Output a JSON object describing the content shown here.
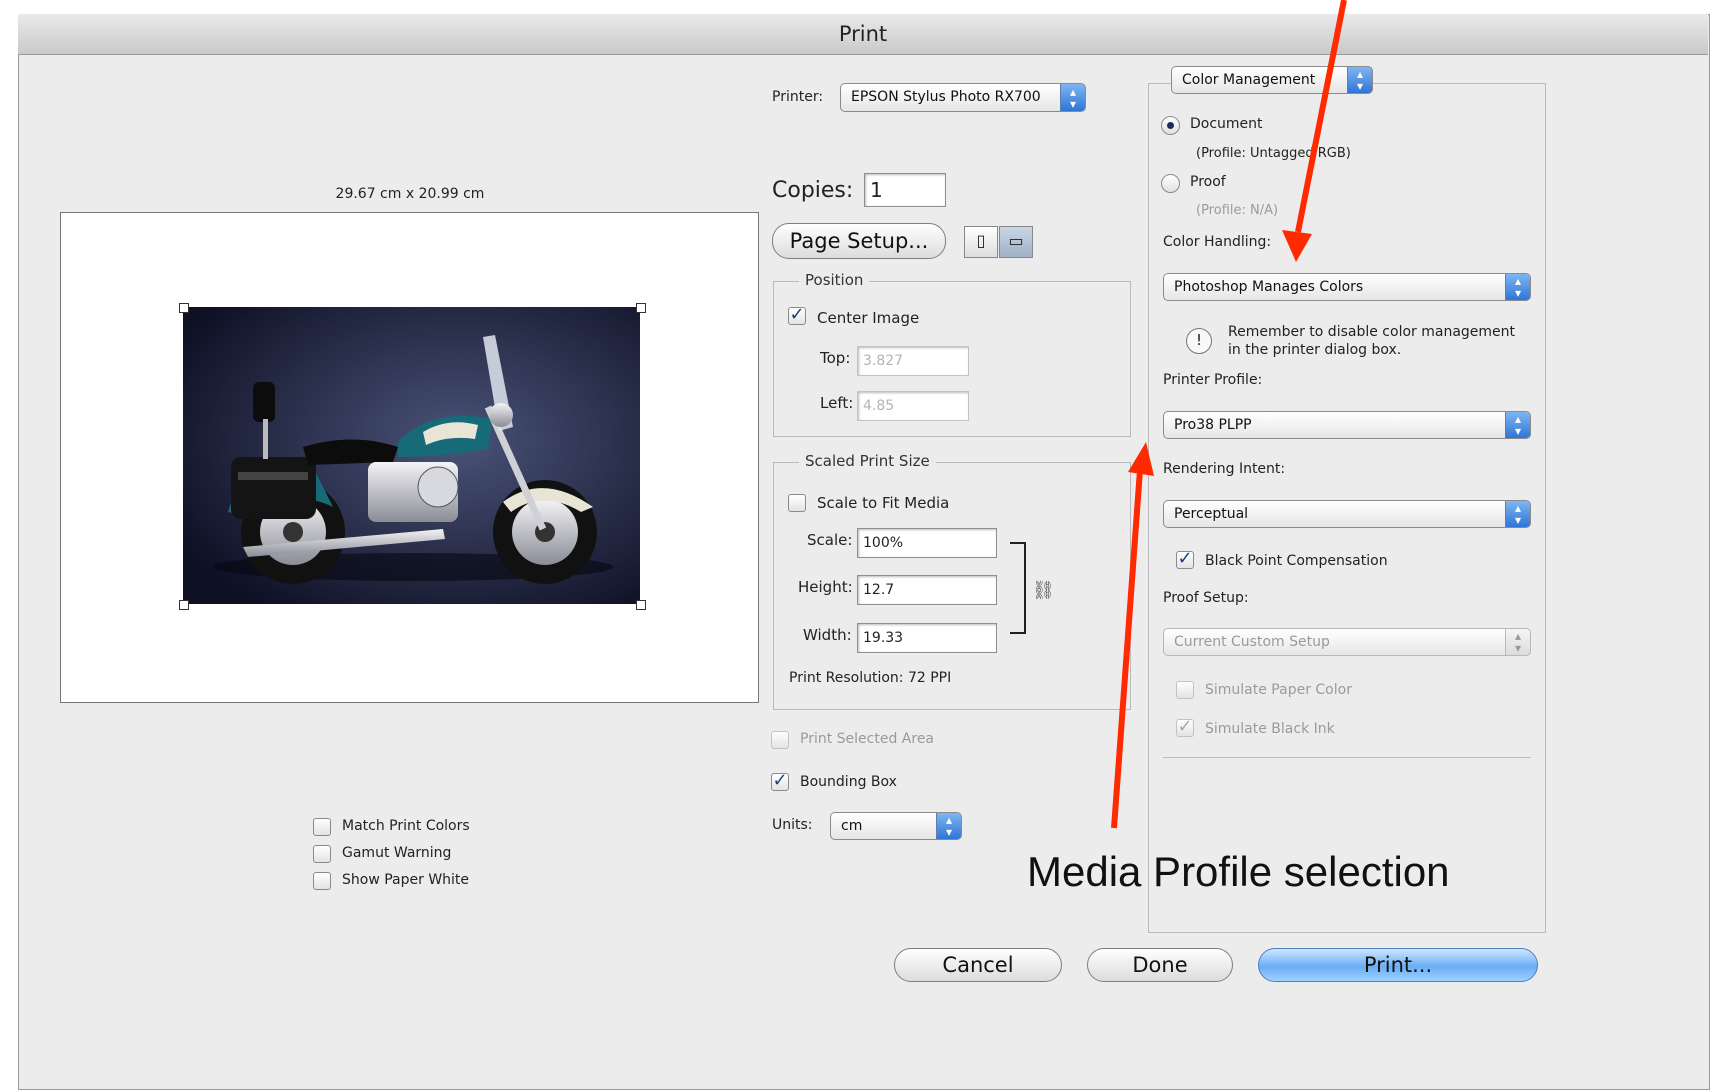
{
  "window": {
    "title": "Print"
  },
  "preview": {
    "dimensions": "29.67 cm x 20.99 cm",
    "image_description_icon": "motorcycle-photo"
  },
  "preview_options": [
    {
      "label": "Match Print Colors",
      "checked": false
    },
    {
      "label": "Gamut Warning",
      "checked": false
    },
    {
      "label": "Show Paper White",
      "checked": false
    }
  ],
  "printer": {
    "label": "Printer:",
    "value": "EPSON Stylus Photo RX700"
  },
  "copies": {
    "label": "Copies:",
    "value": "1"
  },
  "page_setup": {
    "label": "Page Setup..."
  },
  "position": {
    "title": "Position",
    "center_image": {
      "label": "Center Image",
      "checked": true
    },
    "top": {
      "label": "Top:",
      "value": "3.827"
    },
    "left": {
      "label": "Left:",
      "value": "4.85"
    }
  },
  "scaled_print_size": {
    "title": "Scaled Print Size",
    "scale_to_fit": {
      "label": "Scale to Fit Media",
      "checked": false
    },
    "scale": {
      "label": "Scale:",
      "value": "100%"
    },
    "height": {
      "label": "Height:",
      "value": "12.7"
    },
    "width": {
      "label": "Width:",
      "value": "19.33"
    },
    "resolution": "Print Resolution: 72 PPI"
  },
  "print_selected_area": {
    "label": "Print Selected Area",
    "checked": false
  },
  "bounding_box": {
    "label": "Bounding Box",
    "checked": true
  },
  "units": {
    "label": "Units:",
    "value": "cm"
  },
  "color_management": {
    "section_popup": "Color Management",
    "document": {
      "label": "Document",
      "profile": "(Profile: Untagged RGB)",
      "selected": true
    },
    "proof": {
      "label": "Proof",
      "profile": "(Profile: N/A)",
      "selected": false
    },
    "color_handling": {
      "label": "Color Handling:",
      "value": "Photoshop Manages Colors"
    },
    "notice": {
      "line1": "Remember to disable color management",
      "line2": "in the printer dialog box."
    },
    "printer_profile": {
      "label": "Printer Profile:",
      "value": "Pro38 PLPP"
    },
    "rendering_intent": {
      "label": "Rendering Intent:",
      "value": "Perceptual"
    },
    "black_point": {
      "label": "Black Point Compensation",
      "checked": true
    },
    "proof_setup": {
      "label": "Proof Setup:",
      "value": "Current Custom Setup"
    },
    "simulate_paper": {
      "label": "Simulate Paper Color",
      "checked": false
    },
    "simulate_ink": {
      "label": "Simulate Black Ink",
      "checked": true
    }
  },
  "buttons": {
    "cancel": "Cancel",
    "done": "Done",
    "print": "Print..."
  },
  "annotation": {
    "text": "Media Profile selection",
    "color": "#ff2a00"
  }
}
